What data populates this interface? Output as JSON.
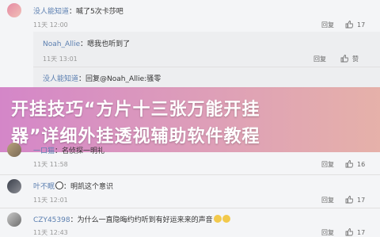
{
  "comments": [
    {
      "user": "没人能知道",
      "text": "喊了5次卡莎吧",
      "time": "11天 12:00",
      "reply": "回复",
      "likes": "17"
    },
    {
      "user": "Noah_Allie",
      "text": "嗯我也听到了",
      "time": "11天 13:01",
      "reply": "回复",
      "likes": "赞"
    },
    {
      "user": "没人能知道",
      "text": "回复@Noah_Allie:骚零",
      "time": "",
      "reply": "",
      "likes": ""
    },
    {
      "user": "一口猫",
      "text": "名侦探一明礼",
      "time": "11天 11:58",
      "reply": "回复",
      "likes": "16"
    },
    {
      "user": "叶不眠",
      "text": "明凯这个意识",
      "time": "11天 12:01",
      "reply": "回复",
      "likes": "17"
    },
    {
      "user": "CZY45398",
      "text": "为什么一直隐晦约约听到有好运来来的声音",
      "time": "11天 12:43",
      "reply": "回复",
      "likes": "17"
    }
  ],
  "banner": {
    "line1": "开挂技巧“方片十三张万能开挂",
    "line2": "器”详细外挂透视辅助软件教程"
  },
  "colors": {
    "username": "#5b7fb0",
    "banner": "#d47fbf"
  }
}
